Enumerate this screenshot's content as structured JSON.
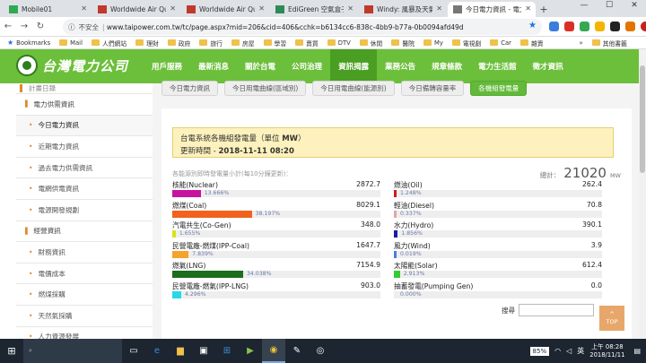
{
  "browser": {
    "tabs": [
      {
        "label": "Mobile01",
        "icon_color": "#33a853",
        "active": false
      },
      {
        "label": "Worldwide Air Qua",
        "icon_color": "#c0392b",
        "active": false
      },
      {
        "label": "Worldwide Air Qua",
        "icon_color": "#c0392b",
        "active": false
      },
      {
        "label": "EdiGreen 空氣盒子",
        "icon_color": "#2e8b57",
        "active": false
      },
      {
        "label": "Windy: 風暴及天氣",
        "icon_color": "#c0392b",
        "active": false
      },
      {
        "label": "今日電力資訊 - 電力",
        "icon_color": "#777777",
        "active": true
      }
    ],
    "new_tab": "+",
    "window_controls": {
      "minimize": "—",
      "maximize": "☐",
      "close": "✕"
    },
    "security_label": "不安全",
    "url": "www.taipower.com.tw/tc/page.aspx?mid=206&cid=406&cchk=b6134cc6-838c-4bb9-b77a-0b0094afd49d",
    "bookmarks": [
      "Bookmarks",
      "Mail",
      "人們網站",
      "理財",
      "政府",
      "旅行",
      "房屋",
      "學習",
      "賣買",
      "DTV",
      "休閒",
      "醫院",
      "My",
      "電視劇",
      "Car",
      "雜賣",
      "»",
      "其他書籤"
    ]
  },
  "site": {
    "logo_text": "台灣電力公司",
    "nav": [
      "用戶服務",
      "最新消息",
      "關於台電",
      "公司治理",
      "資訊揭露",
      "業務公告",
      "規章條款",
      "電力生活館",
      "徵才資訊"
    ],
    "nav_current_index": 4
  },
  "sidebar": {
    "items": [
      {
        "label": "計畫日錄",
        "type": "partial"
      },
      {
        "label": "電力供需資訊",
        "type": "group"
      },
      {
        "label": "今日電力資訊",
        "type": "sub",
        "active": true
      },
      {
        "label": "近期電力資訊",
        "type": "sub"
      },
      {
        "label": "過去電力供需資訊",
        "type": "sub"
      },
      {
        "label": "電網供電資訊",
        "type": "sub"
      },
      {
        "label": "電源開發規劃",
        "type": "sub"
      },
      {
        "label": "經營資訊",
        "type": "group"
      },
      {
        "label": "財務資訊",
        "type": "sub"
      },
      {
        "label": "電價成本",
        "type": "sub"
      },
      {
        "label": "燃煤採購",
        "type": "sub"
      },
      {
        "label": "天然氣採購",
        "type": "sub"
      },
      {
        "label": "人力資源發展",
        "type": "sub"
      }
    ]
  },
  "subtabs": [
    {
      "label": "今日電力資訊",
      "active": false
    },
    {
      "label": "今日用電曲線(區域別)",
      "active": false
    },
    {
      "label": "今日用電曲線(能源別)",
      "active": false
    },
    {
      "label": "今日備轉容量率",
      "active": false
    },
    {
      "label": "各機組發電量",
      "active": true
    }
  ],
  "info": {
    "title_prefix": "台電系統各機組發電量（單位",
    "unit": "MW",
    "title_suffix": "）",
    "update_label": "更新時間 -",
    "update_time": "2018-11-11 08:20"
  },
  "summary": {
    "caption": "各能源別即時發電量小計(每10分鐘更新)：",
    "total_label": "總計：",
    "total_value": "21020",
    "total_unit": "MW"
  },
  "fuels_left": [
    {
      "name": "核能(Nuclear)",
      "value": "2872.7",
      "percent": 13.666,
      "percent_label": "13.666%",
      "color": "#c8139e"
    },
    {
      "name": "燃煤(Coal)",
      "value": "8029.1",
      "percent": 38.197,
      "percent_label": "38.197%",
      "color": "#f0621e"
    },
    {
      "name": "汽電共生(Co-Gen)",
      "value": "348.0",
      "percent": 1.655,
      "percent_label": "1.655%",
      "color": "#d8e21a"
    },
    {
      "name": "民營電廠-燃煤(IPP-Coal)",
      "value": "1647.7",
      "percent": 7.839,
      "percent_label": "7.839%",
      "color": "#f5a32a"
    },
    {
      "name": "燃氣(LNG)",
      "value": "7154.9",
      "percent": 34.038,
      "percent_label": "34.038%",
      "color": "#1d6e1d"
    },
    {
      "name": "民營電廠-燃氣(IPP-LNG)",
      "value": "903.0",
      "percent": 4.296,
      "percent_label": "4.296%",
      "color": "#27d8e8"
    }
  ],
  "fuels_right": [
    {
      "name": "燃油(Oil)",
      "value": "262.4",
      "percent": 1.248,
      "percent_label": "1.248%",
      "color": "#d3181f"
    },
    {
      "name": "輕油(Diesel)",
      "value": "70.8",
      "percent": 0.337,
      "percent_label": "0.337%",
      "color": "#e8a3a3"
    },
    {
      "name": "水力(Hydro)",
      "value": "390.1",
      "percent": 1.856,
      "percent_label": "1.856%",
      "color": "#1a1aa8"
    },
    {
      "name": "風力(Wind)",
      "value": "3.9",
      "percent": 0.019,
      "percent_label": "0.019%",
      "color": "#4a7ee0"
    },
    {
      "name": "太陽能(Solar)",
      "value": "612.4",
      "percent": 2.913,
      "percent_label": "2.913%",
      "color": "#33cc33"
    },
    {
      "name": "抽蓄發電(Pumping Gen)",
      "value": "0.0",
      "percent": 0.0,
      "percent_label": "0.000%",
      "color": "#8888cc"
    }
  ],
  "search": {
    "label": "搜尋",
    "value": ""
  },
  "top_button": {
    "arrow": "^",
    "label": "TOP"
  },
  "taskbar": {
    "battery": "85%",
    "ime": "英",
    "time": "上午 08:28",
    "date": "2018/11/11"
  }
}
